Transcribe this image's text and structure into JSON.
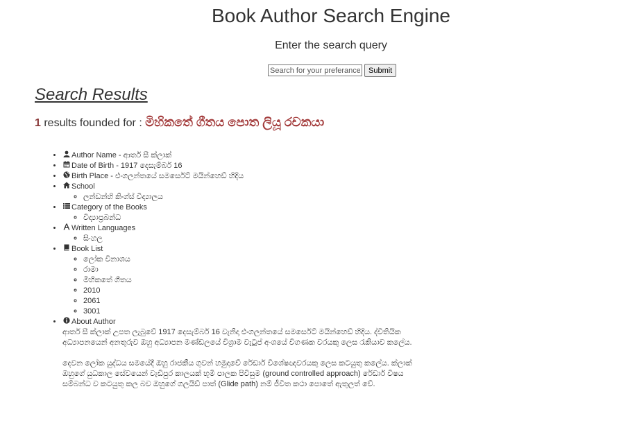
{
  "header": {
    "title": "Book Author Search Engine",
    "subtitle": "Enter the search query"
  },
  "search": {
    "placeholder": "Search for your preferance",
    "value": "",
    "submit_label": "Submit"
  },
  "results": {
    "heading": "Search Results",
    "count": "1",
    "count_text": " results founded for : ",
    "query": "මිහිකතේ ගීතය පොත ලියූ රචකයා"
  },
  "author": {
    "name_label": "Author Name - ආතර් සී ක්ලාක්",
    "dob_label": "Date of Birth - 1917 දෙසැම්බර් 16",
    "birthplace_label": "Birth Place - එංගලන්තයේ සමර්සෙට් මයින්හෙඩ් හිදිය",
    "school_label": "School",
    "school_items": [
      "ලන්ඩන්හි කිංග්ස් විද්‍යාලය"
    ],
    "category_label": "Category of the Books",
    "category_items": [
      "විද්‍යාප්‍රබන්ධ"
    ],
    "languages_label": "Written Languages",
    "language_items": [
      "සිංහල"
    ],
    "booklist_label": "Book List",
    "book_items": [
      "ලෝක විනාශය",
      "රාමා",
      "මිහිකතේ ගීතය",
      "2010",
      "2061",
      "3001"
    ],
    "about_label": "About Author",
    "about_p1": "ආතර් සී ක්ලාක් උපත ලැබුවේ 1917 දෙසැම්බර් 16 වැනිදා එංගලන්තයේ සමර්සෙට් මයින්හෙඩ් හිදිය. ද්විතියික අධ්‍යාපනයෙන් අනතුරුව ඔහු අධ්‍යාපන මණ්ඩලයේ විශ්‍රාම වැටුප් අංශයේ විගණක වරයකු ලෙස රැකියාව කලේය.",
    "about_p2": "දෙවන ලෝක යුද්ධය සමයේදී ඔහු රාජකීය ගුවන් හමුදාවේ රේඩාර් විශේෂඥවරයකු ලෙස කටයුතු කලේය. ක්ලාක් ඔහුගේ යුධකාල සේවයෙන් වැඩිපුර කාලයක් භූමි පාලක පිවිසුම (ground controlled approach) රේඩාර් විෂය සම්බන්ධ ව කටයුතු කල බව ඔහුගේ ගලයිඩ් පාත් (Glide path) නම් ජීවිත කථා පොතේ ඇතුලත් වේ."
  },
  "icons": {
    "author": "user-icon",
    "dob": "calendar-icon",
    "birthplace": "globe-icon",
    "school": "home-icon",
    "category": "list-icon",
    "languages": "font-icon",
    "booklist": "book-icon",
    "about": "info-circle-icon"
  },
  "colors": {
    "query": "#a33b3b",
    "count": "#8b3a3a",
    "text": "#333333"
  }
}
